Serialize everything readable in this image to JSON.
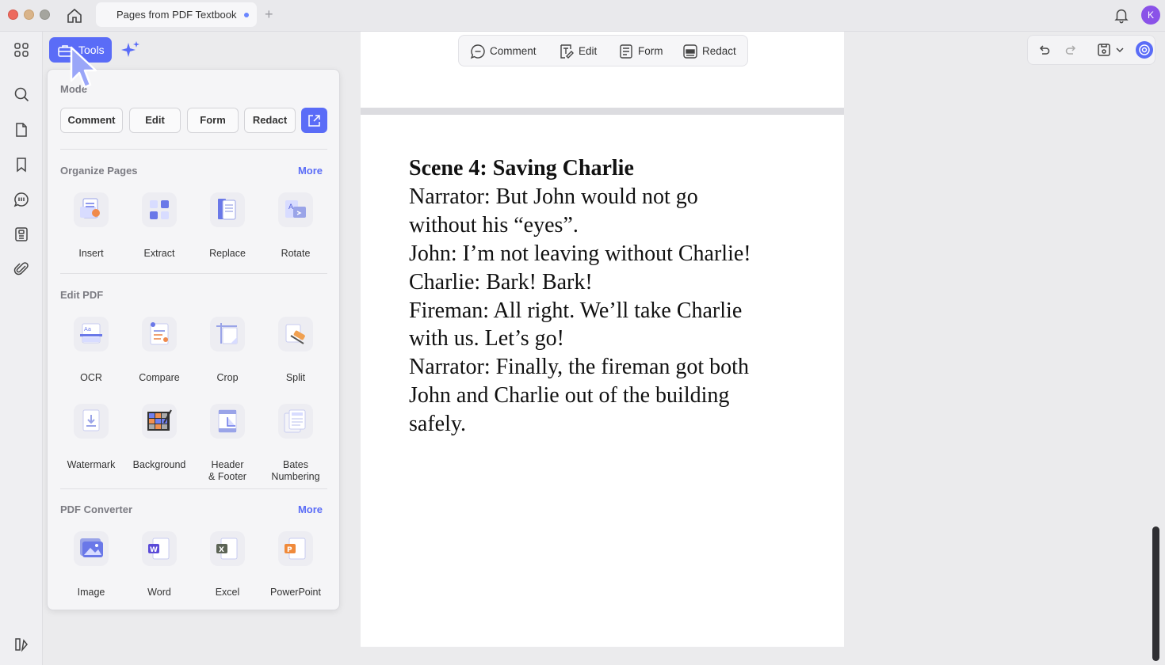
{
  "window": {
    "tab_title": "Pages from PDF Textbook",
    "avatar_initial": "K"
  },
  "toolbar": {
    "tools_label": "Tools"
  },
  "panel": {
    "mode_title": "Mode",
    "modes": [
      "Comment",
      "Edit",
      "Form",
      "Redact"
    ],
    "organize_title": "Organize Pages",
    "organize_more": "More",
    "organize_tools": [
      "Insert",
      "Extract",
      "Replace",
      "Rotate"
    ],
    "edit_title": "Edit PDF",
    "edit_tools_row1": [
      "OCR",
      "Compare",
      "Crop",
      "Split"
    ],
    "edit_tools_row2": [
      "Watermark",
      "Background",
      "Header\n& Footer",
      "Bates\nNumbering"
    ],
    "converter_title": "PDF Converter",
    "converter_more": "More",
    "converter_tools": [
      "Image",
      "Word",
      "Excel",
      "PowerPoint"
    ]
  },
  "mode_bar": {
    "comment": "Comment",
    "edit": "Edit",
    "form": "Form",
    "redact": "Redact"
  },
  "document": {
    "heading": "Scene 4: Saving Charlie",
    "lines": [
      "Narrator: But John would not go",
      "without his “eyes”.",
      "John: I’m not leaving without Charlie!",
      "Charlie: Bark! Bark!",
      "Fireman: All right. We’ll take Charlie",
      "with us. Let’s go!",
      "Narrator: Finally, the fireman got both",
      "John and Charlie out of the building",
      "safely."
    ]
  },
  "colors": {
    "accent": "#5a6cf7",
    "panel_bg": "#f5f5f7",
    "page_bg": "#ffffff"
  },
  "icons": {
    "rail": [
      "grid-icon",
      "search-icon",
      "page-icon",
      "bookmark-icon",
      "comment-list-icon",
      "stamp-icon",
      "attachment-icon",
      "sidebar-toggle-icon"
    ]
  }
}
